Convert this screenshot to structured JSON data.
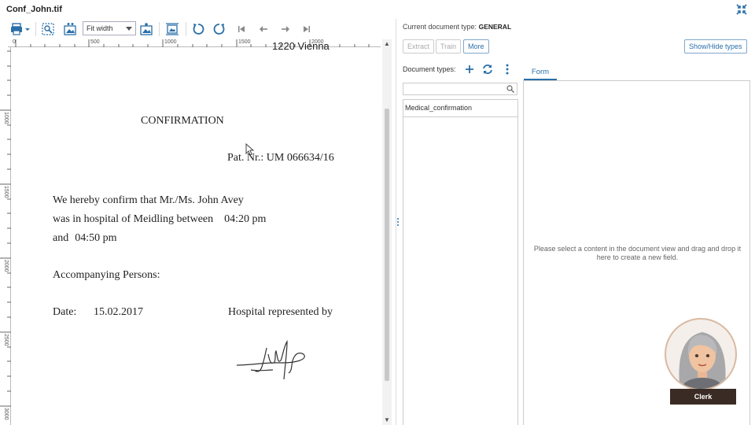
{
  "window": {
    "title": "Conf_John.tif"
  },
  "toolbar": {
    "zoom_value": "Fit width"
  },
  "ruler": {
    "horizontal": [
      "0",
      "500",
      "1000",
      "1500",
      "2000"
    ],
    "vertical": [
      "1000",
      "1500",
      "2000",
      "2500",
      "3000"
    ]
  },
  "document": {
    "address_fragment": "1220 Vienna",
    "heading": "CONFIRMATION",
    "patient_number": "Pat. Nr.: UM 066634/16",
    "line1": "We hereby confirm that Mr./Ms. John Avey",
    "line2_prefix": "was in hospital of Meidling between",
    "line2_time": "04:20 pm",
    "line3_prefix": "and",
    "line3_time": "04:50 pm",
    "accompanying": "Accompanying Persons:",
    "date_label": "Date:",
    "date_value": "15.02.2017",
    "represented_by": "Hospital represented by"
  },
  "panel": {
    "current_type_label": "Current document type:",
    "current_type_value": "GENERAL",
    "extract_label": "Extract",
    "train_label": "Train",
    "more_label": "More",
    "show_hide_label": "Show/Hide types",
    "doc_types_label": "Document types:",
    "doc_types": [
      "Medical_confirmation"
    ],
    "form_tab_label": "Form",
    "form_hint": "Please select a content in the document view and drag and drop it here to create a new field."
  },
  "avatar": {
    "label": "Clerk"
  },
  "colors": {
    "accent": "#2a6fa8",
    "avatar_label_bg": "#3a2c24"
  }
}
